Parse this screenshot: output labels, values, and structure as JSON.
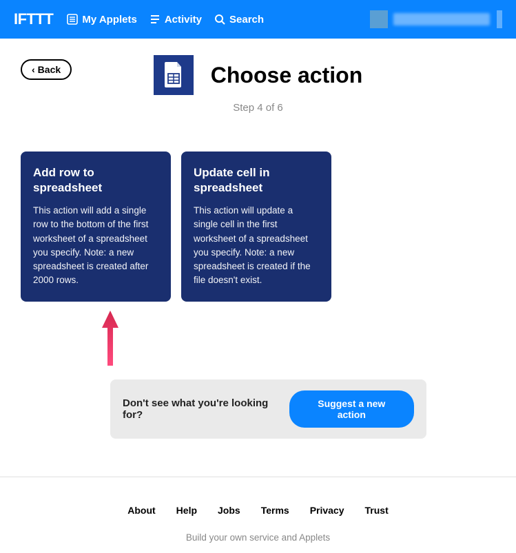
{
  "header": {
    "logo": "IFTTT",
    "nav": {
      "applets": "My Applets",
      "activity": "Activity",
      "search": "Search"
    }
  },
  "back": {
    "label": "Back"
  },
  "page": {
    "title": "Choose action",
    "step": "Step 4 of 6"
  },
  "cards": [
    {
      "title": "Add row to spreadsheet",
      "desc": "This action will add a single row to the bottom of the first worksheet of a spreadsheet you specify. Note: a new spreadsheet is created after 2000 rows."
    },
    {
      "title": "Update cell in spreadsheet",
      "desc": "This action will update a single cell in the first worksheet of a spreadsheet you specify. Note: a new spreadsheet is created if the file doesn't exist."
    }
  ],
  "suggest": {
    "text": "Don't see what you're looking for?",
    "button": "Suggest a new action"
  },
  "footer": {
    "links": [
      "About",
      "Help",
      "Jobs",
      "Terms",
      "Privacy",
      "Trust"
    ],
    "tagline": "Build your own service and Applets"
  }
}
